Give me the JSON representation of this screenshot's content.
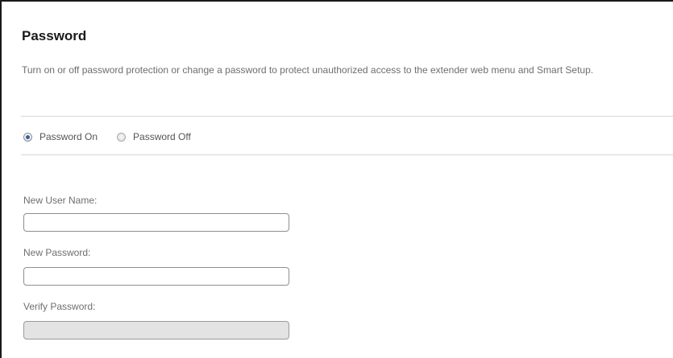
{
  "section": {
    "title": "Password",
    "description": "Turn on or off password protection or change a password to protect unauthorized access to the extender web menu and Smart Setup."
  },
  "password_mode": {
    "options": [
      {
        "label": "Password On",
        "selected": true
      },
      {
        "label": "Password Off",
        "selected": false
      }
    ]
  },
  "fields": {
    "new_user_name": {
      "label": "New User Name:",
      "value": "",
      "enabled": true
    },
    "new_password": {
      "label": "New Password:",
      "value": "",
      "enabled": true
    },
    "verify_password": {
      "label": "Verify Password:",
      "value": "",
      "enabled": false
    }
  },
  "colors": {
    "text": "#6e6e6e",
    "title": "#1a1a1a",
    "radio_selected": "#2f5fa8",
    "disabled_field": "#e3e3e3"
  }
}
